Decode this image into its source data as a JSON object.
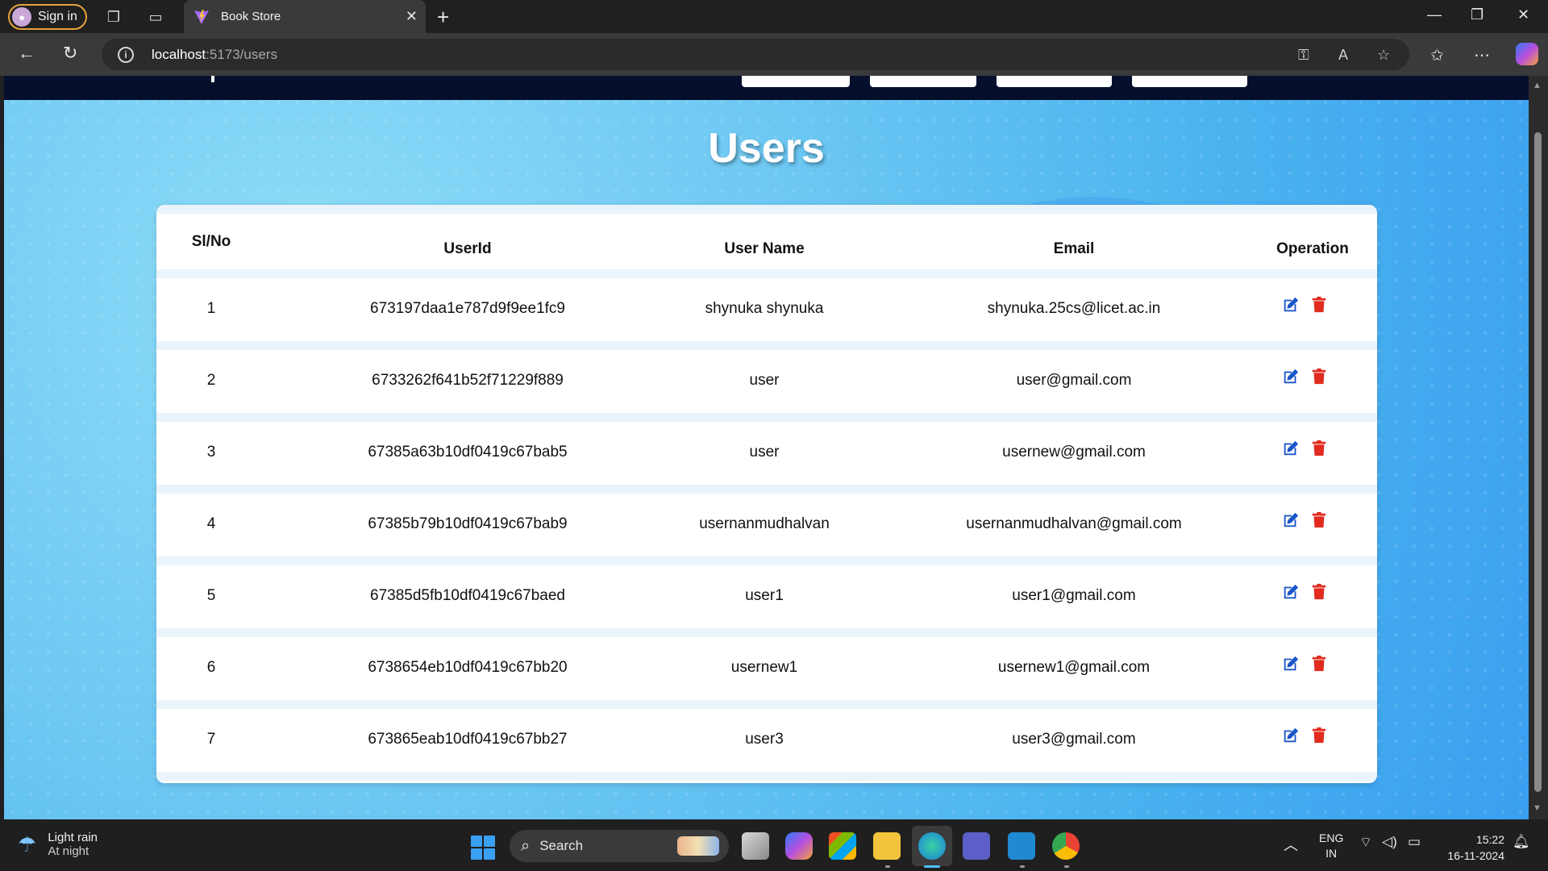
{
  "browser": {
    "signin_label": "Sign in",
    "tab_title": "Book Store",
    "url_host": "localhost",
    "url_path": ":5173/users"
  },
  "page": {
    "title": "Users",
    "columns": [
      "Sl/No",
      "UserId",
      "User Name",
      "Email",
      "Operation"
    ],
    "rows": [
      {
        "sl": "1",
        "id": "673197daa1e787d9f9ee1fc9",
        "name": "shynuka shynuka",
        "email": "shynuka.25cs@licet.ac.in"
      },
      {
        "sl": "2",
        "id": "6733262f641b52f71229f889",
        "name": "user",
        "email": "user@gmail.com"
      },
      {
        "sl": "3",
        "id": "67385a63b10df0419c67bab5",
        "name": "user",
        "email": "usernew@gmail.com"
      },
      {
        "sl": "4",
        "id": "67385b79b10df0419c67bab9",
        "name": "usernanmudhalvan",
        "email": "usernanmudhalvan@gmail.com"
      },
      {
        "sl": "5",
        "id": "67385d5fb10df0419c67baed",
        "name": "user1",
        "email": "user1@gmail.com"
      },
      {
        "sl": "6",
        "id": "6738654eb10df0419c67bb20",
        "name": "usernew1",
        "email": "usernew1@gmail.com"
      },
      {
        "sl": "7",
        "id": "673865eab10df0419c67bb27",
        "name": "user3",
        "email": "user3@gmail.com"
      }
    ],
    "edit_color": "#1a56c8",
    "delete_color": "#e02b1e"
  },
  "taskbar": {
    "weather_title": "Light rain",
    "weather_sub": "At night",
    "search_label": "Search",
    "lang_1": "ENG",
    "lang_2": "IN",
    "time": "15:22",
    "date": "16-11-2024"
  }
}
